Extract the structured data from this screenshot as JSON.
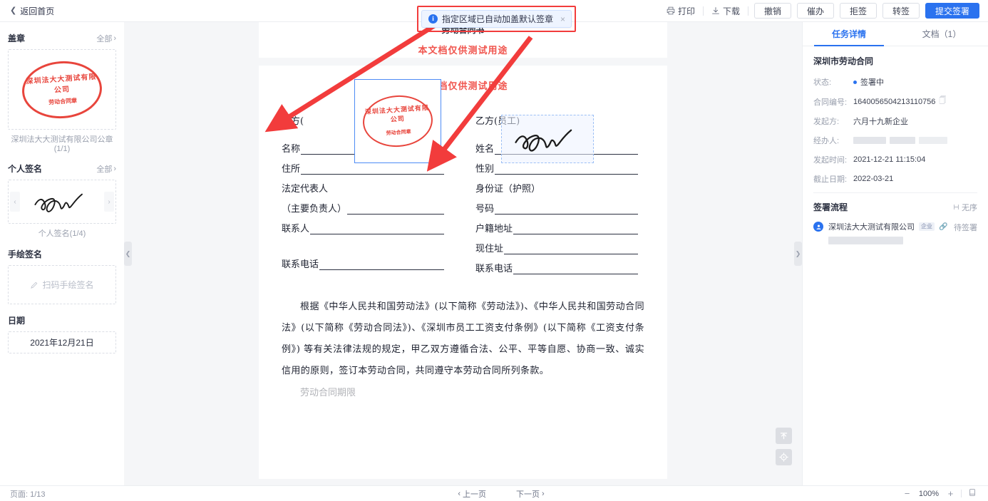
{
  "topbar": {
    "back_label": "返回首页",
    "print_label": "打印",
    "download_label": "下载",
    "buttons": [
      {
        "label": "撤销",
        "primary": false
      },
      {
        "label": "催办",
        "primary": false
      },
      {
        "label": "拒签",
        "primary": false
      },
      {
        "label": "转签",
        "primary": false
      },
      {
        "label": "提交签署",
        "primary": true
      }
    ]
  },
  "notification": {
    "text": "指定区域已自动加盖默认签章",
    "close_label": "×",
    "icon": "info-icon",
    "highlight_color": "#f23c3c"
  },
  "sidebar": {
    "seal_section": {
      "title": "盖章",
      "all_label": "全部",
      "seal_top_text": "深圳法大大测试有限公司",
      "seal_bottom_text": "劳动合同章",
      "caption": "深圳法大大测试有限公司公章(1/1)"
    },
    "personal_sign_section": {
      "title": "个人签名",
      "all_label": "全部",
      "caption": "个人签名(1/4)",
      "prev_label": "‹",
      "next_label": "›"
    },
    "hand_sign_section": {
      "title": "手绘签名",
      "placeholder": "扫码手绘签名"
    },
    "date_section": {
      "title": "日期",
      "value": "2021年12月21日"
    }
  },
  "document": {
    "watermark_top": "本文档仅供测试用途",
    "watermark_second": "本文档仅供测试用途",
    "title": "劳动合同书",
    "party_a": {
      "heading": "甲方(",
      "fields": [
        {
          "label": "名称",
          "line": true
        },
        {
          "label": "住所",
          "line": true
        },
        {
          "label": "法定代表人",
          "line": false
        },
        {
          "label": "（主要负责人）",
          "line": true
        },
        {
          "label": "联系人",
          "line": true
        },
        {
          "label": "",
          "line": false
        },
        {
          "label": "联系电话",
          "line": true
        }
      ]
    },
    "party_b": {
      "heading": "乙方(员工)",
      "fields": [
        {
          "label": "姓名",
          "line": true
        },
        {
          "label": "性别",
          "line": true
        },
        {
          "label": "身份证（护照）",
          "line": false
        },
        {
          "label": "号码",
          "line": true
        },
        {
          "label": "户籍地址",
          "line": true
        },
        {
          "label": "现住址",
          "line": true
        },
        {
          "label": "联系电话",
          "line": true
        }
      ]
    },
    "paragraph": "根据《中华人民共和国劳动法》(以下简称《劳动法》)、《中华人民共和国劳动合同法》(以下简称《劳动合同法》)、《深圳市员工工资支付条例》(以下简称《工资支付条例》) 等有关法律法规的规定，甲乙双方遵循合法、公平、平等自愿、协商一致、诚实信用的原则，签订本劳动合同，共同遵守本劳动合同所列条款。",
    "paragraph_cut": "劳动合同期限",
    "seal_field_top_text": "深圳法大大测试有限公司",
    "seal_field_bottom_text": "劳动合同章"
  },
  "float_buttons": [
    {
      "name": "scroll-to-top",
      "glyph": "↑"
    },
    {
      "name": "locate",
      "glyph": "◉"
    }
  ],
  "bottombar": {
    "page_label": "页面:",
    "page_value": "1/13",
    "prev_page": "上一页",
    "next_page": "下一页",
    "zoom_out": "−",
    "zoom_level": "100%",
    "zoom_in": "+",
    "fit_icon": "fit-page-icon"
  },
  "rightpanel": {
    "tabs": [
      {
        "label": "任务详情",
        "active": true
      },
      {
        "label": "文档（1）",
        "active": false
      }
    ],
    "contract_title": "深圳市劳动合同",
    "details": [
      {
        "key": "状态:",
        "value": "签署中",
        "type": "status"
      },
      {
        "key": "合同编号:",
        "value": "1640056504213110756",
        "type": "copy"
      },
      {
        "key": "发起方:",
        "value": "六月十九新企业",
        "type": "text"
      },
      {
        "key": "经办人:",
        "value": "",
        "type": "redacted"
      },
      {
        "key": "发起时间:",
        "value": "2021-12-21 11:15:04",
        "type": "text"
      },
      {
        "key": "截止日期:",
        "value": "2022-03-21",
        "type": "text"
      }
    ],
    "flow": {
      "title": "签署流程",
      "order_label": "无序",
      "items": [
        {
          "name": "深圳法大大测试有限公司",
          "badge": "企业",
          "status": "待签署"
        }
      ]
    }
  },
  "colors": {
    "accent": "#2a72ef",
    "seal_red": "#e8453c",
    "alert_red": "#f23c3c",
    "watermark": "#f0554e"
  }
}
